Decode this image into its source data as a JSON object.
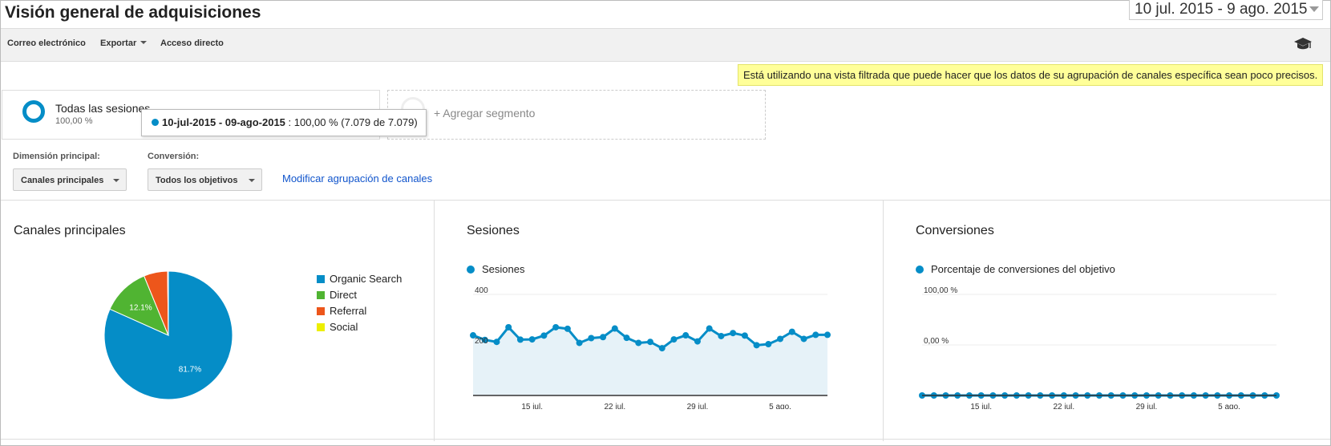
{
  "header": {
    "title": "Visión general de adquisiciones",
    "date_range": "10 jul. 2015 - 9 ago. 2015"
  },
  "toolbar": {
    "email": "Correo electrónico",
    "export": "Exportar",
    "shortcut": "Acceso directo",
    "help_icon": "graduation-cap-icon"
  },
  "warning": "Está utilizando una vista filtrada que puede hacer que los datos de su agrupación de canales específica sean poco precisos.",
  "segment": {
    "name": "Todas las sesiones",
    "pct": "100,00 %",
    "tooltip_range": "10-jul-2015 - 09-ago-2015",
    "tooltip_value": " : 100,00 % (7.079 de 7.079)",
    "add_label": "+ Agregar segmento"
  },
  "controls": {
    "dimension_label": "Dimensión principal:",
    "dimension_value": "Canales principales",
    "conversion_label": "Conversión:",
    "conversion_value": "Todos los objetivos",
    "modify_link": "Modificar agrupación de canales"
  },
  "panels": {
    "channels_title": "Canales principales",
    "sessions_title": "Sesiones",
    "conversions_title": "Conversiones",
    "sessions_series": "Sesiones",
    "conversions_series": "Porcentaje de conversiones del objetivo"
  },
  "colors": {
    "accent": "#058dc7",
    "organic": "#058dc7",
    "direct": "#50b432",
    "referral": "#ed561b",
    "social": "#edef00"
  },
  "chart_data": [
    {
      "type": "pie",
      "slices": [
        {
          "label": "Organic Search",
          "value": 81.7,
          "color": "#058dc7",
          "label_text": "81.7%"
        },
        {
          "label": "Direct",
          "value": 12.1,
          "color": "#50b432",
          "label_text": "12.1%"
        },
        {
          "label": "Referral",
          "value": 6.0,
          "color": "#ed561b",
          "label_text": ""
        },
        {
          "label": "Social",
          "value": 0.2,
          "color": "#edef00",
          "label_text": ""
        }
      ],
      "legend_position": "right"
    },
    {
      "type": "area",
      "series": [
        {
          "name": "Sesiones",
          "values": [
            238,
            220,
            212,
            270,
            221,
            222,
            237,
            270,
            264,
            208,
            227,
            231,
            265,
            228,
            208,
            212,
            187,
            222,
            238,
            214,
            265,
            235,
            247,
            237,
            199,
            203,
            224,
            252,
            224,
            240,
            240
          ]
        }
      ],
      "x_tick_labels": [
        "15 jul.",
        "22 jul.",
        "29 jul.",
        "5 ago."
      ],
      "y_tick_labels": [
        "400",
        "200"
      ],
      "ylim": [
        0,
        400
      ]
    },
    {
      "type": "line",
      "series": [
        {
          "name": "Porcentaje de conversiones del objetivo",
          "values": [
            0,
            0,
            0,
            0,
            0,
            0,
            0,
            0,
            0,
            0,
            0,
            0,
            0,
            0,
            0,
            0,
            0,
            0,
            0,
            0,
            0,
            0,
            0,
            0,
            0,
            0,
            0,
            0,
            0,
            0,
            0
          ]
        }
      ],
      "x_tick_labels": [
        "15 jul.",
        "22 jul.",
        "29 jul.",
        "5 ago."
      ],
      "y_tick_labels": [
        "100,00 %",
        "0,00 %"
      ],
      "ylim": [
        0,
        100
      ]
    }
  ]
}
